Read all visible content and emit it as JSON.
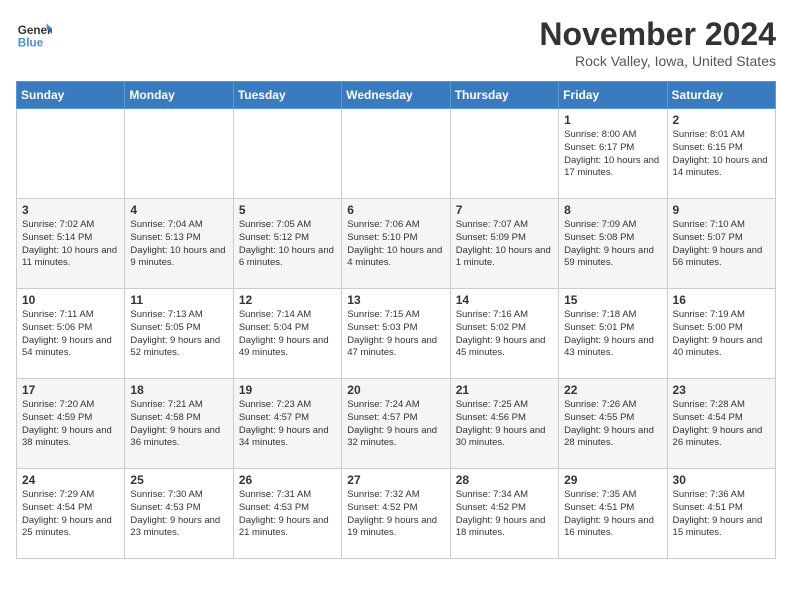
{
  "header": {
    "logo_line1": "General",
    "logo_line2": "Blue",
    "month": "November 2024",
    "location": "Rock Valley, Iowa, United States"
  },
  "weekdays": [
    "Sunday",
    "Monday",
    "Tuesday",
    "Wednesday",
    "Thursday",
    "Friday",
    "Saturday"
  ],
  "weeks": [
    [
      {
        "day": "",
        "info": ""
      },
      {
        "day": "",
        "info": ""
      },
      {
        "day": "",
        "info": ""
      },
      {
        "day": "",
        "info": ""
      },
      {
        "day": "",
        "info": ""
      },
      {
        "day": "1",
        "info": "Sunrise: 8:00 AM\nSunset: 6:17 PM\nDaylight: 10 hours\nand 17 minutes."
      },
      {
        "day": "2",
        "info": "Sunrise: 8:01 AM\nSunset: 6:15 PM\nDaylight: 10 hours\nand 14 minutes."
      }
    ],
    [
      {
        "day": "3",
        "info": "Sunrise: 7:02 AM\nSunset: 5:14 PM\nDaylight: 10 hours\nand 11 minutes."
      },
      {
        "day": "4",
        "info": "Sunrise: 7:04 AM\nSunset: 5:13 PM\nDaylight: 10 hours\nand 9 minutes."
      },
      {
        "day": "5",
        "info": "Sunrise: 7:05 AM\nSunset: 5:12 PM\nDaylight: 10 hours\nand 6 minutes."
      },
      {
        "day": "6",
        "info": "Sunrise: 7:06 AM\nSunset: 5:10 PM\nDaylight: 10 hours\nand 4 minutes."
      },
      {
        "day": "7",
        "info": "Sunrise: 7:07 AM\nSunset: 5:09 PM\nDaylight: 10 hours\nand 1 minute."
      },
      {
        "day": "8",
        "info": "Sunrise: 7:09 AM\nSunset: 5:08 PM\nDaylight: 9 hours\nand 59 minutes."
      },
      {
        "day": "9",
        "info": "Sunrise: 7:10 AM\nSunset: 5:07 PM\nDaylight: 9 hours\nand 56 minutes."
      }
    ],
    [
      {
        "day": "10",
        "info": "Sunrise: 7:11 AM\nSunset: 5:06 PM\nDaylight: 9 hours\nand 54 minutes."
      },
      {
        "day": "11",
        "info": "Sunrise: 7:13 AM\nSunset: 5:05 PM\nDaylight: 9 hours\nand 52 minutes."
      },
      {
        "day": "12",
        "info": "Sunrise: 7:14 AM\nSunset: 5:04 PM\nDaylight: 9 hours\nand 49 minutes."
      },
      {
        "day": "13",
        "info": "Sunrise: 7:15 AM\nSunset: 5:03 PM\nDaylight: 9 hours\nand 47 minutes."
      },
      {
        "day": "14",
        "info": "Sunrise: 7:16 AM\nSunset: 5:02 PM\nDaylight: 9 hours\nand 45 minutes."
      },
      {
        "day": "15",
        "info": "Sunrise: 7:18 AM\nSunset: 5:01 PM\nDaylight: 9 hours\nand 43 minutes."
      },
      {
        "day": "16",
        "info": "Sunrise: 7:19 AM\nSunset: 5:00 PM\nDaylight: 9 hours\nand 40 minutes."
      }
    ],
    [
      {
        "day": "17",
        "info": "Sunrise: 7:20 AM\nSunset: 4:59 PM\nDaylight: 9 hours\nand 38 minutes."
      },
      {
        "day": "18",
        "info": "Sunrise: 7:21 AM\nSunset: 4:58 PM\nDaylight: 9 hours\nand 36 minutes."
      },
      {
        "day": "19",
        "info": "Sunrise: 7:23 AM\nSunset: 4:57 PM\nDaylight: 9 hours\nand 34 minutes."
      },
      {
        "day": "20",
        "info": "Sunrise: 7:24 AM\nSunset: 4:57 PM\nDaylight: 9 hours\nand 32 minutes."
      },
      {
        "day": "21",
        "info": "Sunrise: 7:25 AM\nSunset: 4:56 PM\nDaylight: 9 hours\nand 30 minutes."
      },
      {
        "day": "22",
        "info": "Sunrise: 7:26 AM\nSunset: 4:55 PM\nDaylight: 9 hours\nand 28 minutes."
      },
      {
        "day": "23",
        "info": "Sunrise: 7:28 AM\nSunset: 4:54 PM\nDaylight: 9 hours\nand 26 minutes."
      }
    ],
    [
      {
        "day": "24",
        "info": "Sunrise: 7:29 AM\nSunset: 4:54 PM\nDaylight: 9 hours\nand 25 minutes."
      },
      {
        "day": "25",
        "info": "Sunrise: 7:30 AM\nSunset: 4:53 PM\nDaylight: 9 hours\nand 23 minutes."
      },
      {
        "day": "26",
        "info": "Sunrise: 7:31 AM\nSunset: 4:53 PM\nDaylight: 9 hours\nand 21 minutes."
      },
      {
        "day": "27",
        "info": "Sunrise: 7:32 AM\nSunset: 4:52 PM\nDaylight: 9 hours\nand 19 minutes."
      },
      {
        "day": "28",
        "info": "Sunrise: 7:34 AM\nSunset: 4:52 PM\nDaylight: 9 hours\nand 18 minutes."
      },
      {
        "day": "29",
        "info": "Sunrise: 7:35 AM\nSunset: 4:51 PM\nDaylight: 9 hours\nand 16 minutes."
      },
      {
        "day": "30",
        "info": "Sunrise: 7:36 AM\nSunset: 4:51 PM\nDaylight: 9 hours\nand 15 minutes."
      }
    ]
  ]
}
